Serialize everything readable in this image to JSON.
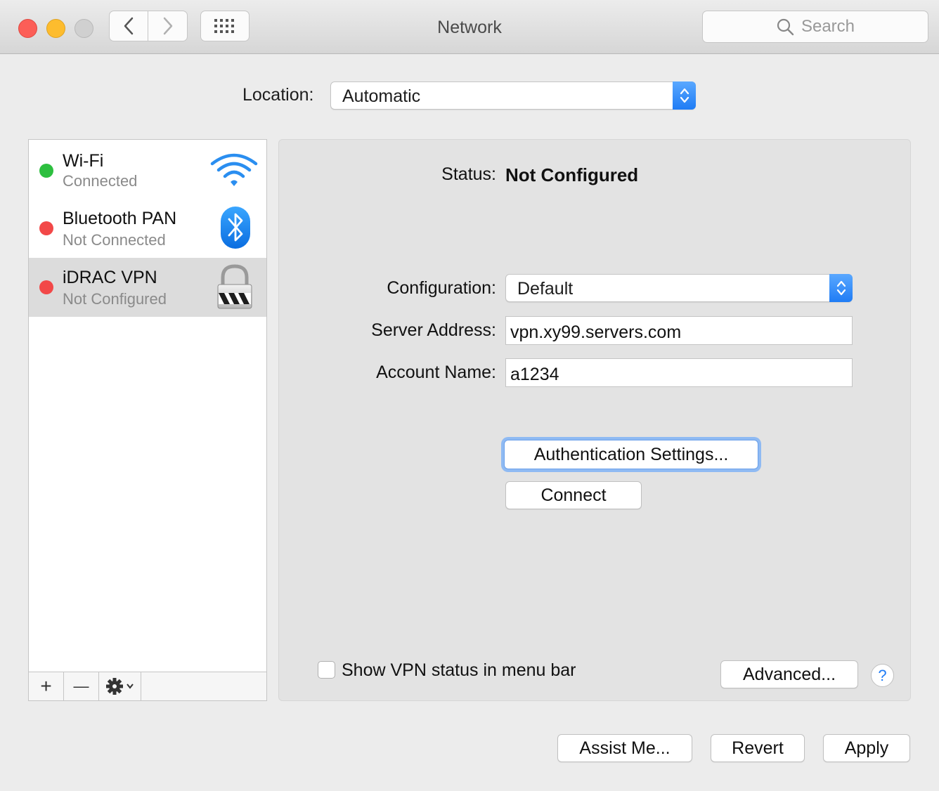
{
  "window": {
    "title": "Network",
    "search_placeholder": "Search"
  },
  "location": {
    "label": "Location:",
    "value": "Automatic"
  },
  "services": [
    {
      "name": "Wi-Fi",
      "status": "Connected",
      "indicator": "#2dbf3f",
      "icon": "wifi-icon"
    },
    {
      "name": "Bluetooth PAN",
      "status": "Not Connected",
      "indicator": "#f24848",
      "icon": "bluetooth-icon"
    },
    {
      "name": "iDRAC VPN",
      "status": "Not Configured",
      "indicator": "#f24848",
      "icon": "vpn-lock-icon",
      "selected": true
    }
  ],
  "sidebar_toolbar": {
    "add": "+",
    "remove": "—"
  },
  "detail": {
    "status_label": "Status:",
    "status_value": "Not Configured",
    "configuration_label": "Configuration:",
    "configuration_value": "Default",
    "server_label": "Server Address:",
    "server_value": "vpn.xy99.servers.com",
    "account_label": "Account Name:",
    "account_value": "a1234",
    "auth_button": "Authentication Settings...",
    "connect_button": "Connect",
    "show_vpn_label": "Show VPN status in menu bar",
    "show_vpn_checked": false,
    "advanced_button": "Advanced...",
    "help": "?"
  },
  "footer": {
    "assist": "Assist Me...",
    "revert": "Revert",
    "apply": "Apply"
  }
}
